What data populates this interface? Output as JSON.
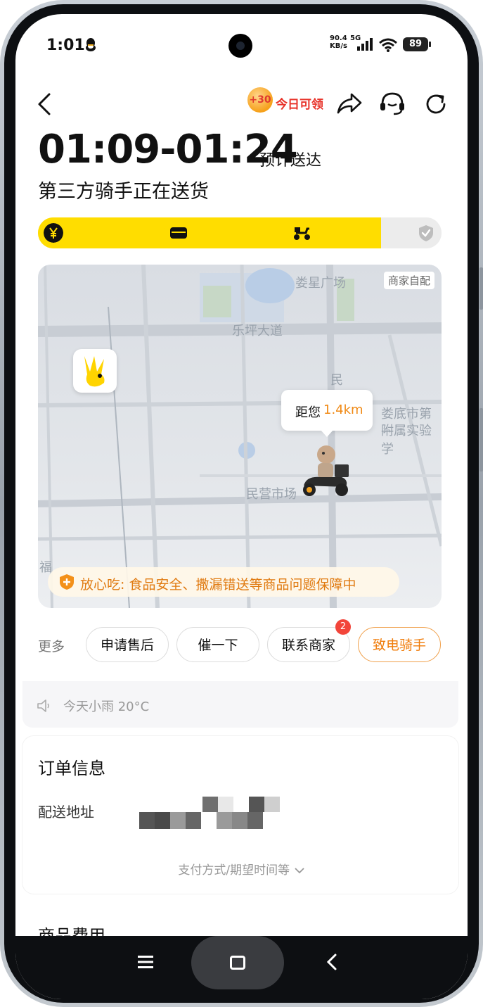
{
  "status_bar": {
    "time": "1:01",
    "net_speed_value": "90.4",
    "net_speed_unit": "KB/s",
    "network": "5G",
    "battery": "89"
  },
  "header": {
    "promo_coin": "+30",
    "promo_text": "今日可领"
  },
  "eta": {
    "time_range": "01:09-01:24",
    "label": "预计送达",
    "status": "第三方骑手正在送货"
  },
  "progress": {
    "fraction": 0.85,
    "steps": [
      "yen-icon",
      "shop-icon",
      "scooter-icon",
      "shield-check-icon"
    ]
  },
  "map": {
    "tag": "商家自配",
    "labels": {
      "plaza": "娄星广场",
      "road": "乐坪大道",
      "school": "娄底市第一",
      "school2": "附属实验学",
      "market": "民营市场",
      "min": "民",
      "fu": "福"
    },
    "distance_prefix": "距您",
    "distance_value": "1.4km",
    "guarantee": "放心吃: 食品安全、撒漏错送等商品问题保障中"
  },
  "actions": {
    "more": "更多",
    "after_sales": "申请售后",
    "urge": "催一下",
    "contact_merchant": "联系商家",
    "contact_badge": "2",
    "call_rider": "致电骑手"
  },
  "weather": {
    "text": "今天小雨 20°C"
  },
  "order": {
    "title": "订单信息",
    "address_label": "配送地址",
    "expand": "支付方式/期望时间等"
  },
  "fees": {
    "title": "商品费用"
  },
  "colors": {
    "brand_yellow": "#ffdd00",
    "accent_orange": "#f07d0c",
    "promo_red": "#e8332a"
  }
}
